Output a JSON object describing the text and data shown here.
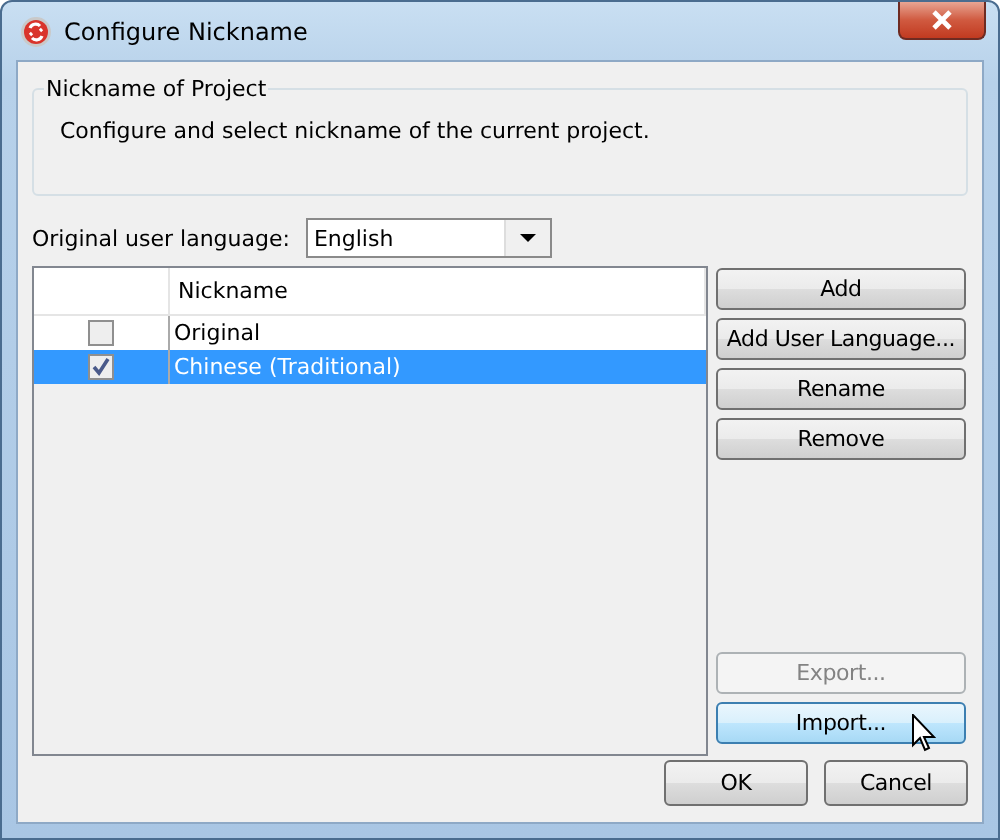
{
  "window": {
    "title": "Configure Nickname"
  },
  "group": {
    "title": "Nickname of Project",
    "description": "Configure and select nickname of the current project."
  },
  "language": {
    "label": "Original user language:",
    "value": "English"
  },
  "table": {
    "header": "Nickname",
    "rows": [
      {
        "checked": false,
        "selected": false,
        "nickname": "Original"
      },
      {
        "checked": true,
        "selected": true,
        "nickname": "Chinese (Traditional)"
      }
    ]
  },
  "side_buttons": [
    {
      "label": "Add",
      "disabled": false,
      "highlighted": false
    },
    {
      "label": "Add User Language...",
      "disabled": false,
      "highlighted": false
    },
    {
      "label": "Rename",
      "disabled": false,
      "highlighted": false
    },
    {
      "label": "Remove",
      "disabled": false,
      "highlighted": false
    }
  ],
  "bottom_side_buttons": [
    {
      "label": "Export...",
      "disabled": true,
      "highlighted": false
    },
    {
      "label": "Import...",
      "disabled": false,
      "highlighted": true
    }
  ],
  "footer_buttons": [
    {
      "label": "OK",
      "disabled": false,
      "highlighted": false
    },
    {
      "label": "Cancel",
      "disabled": false,
      "highlighted": false
    }
  ]
}
